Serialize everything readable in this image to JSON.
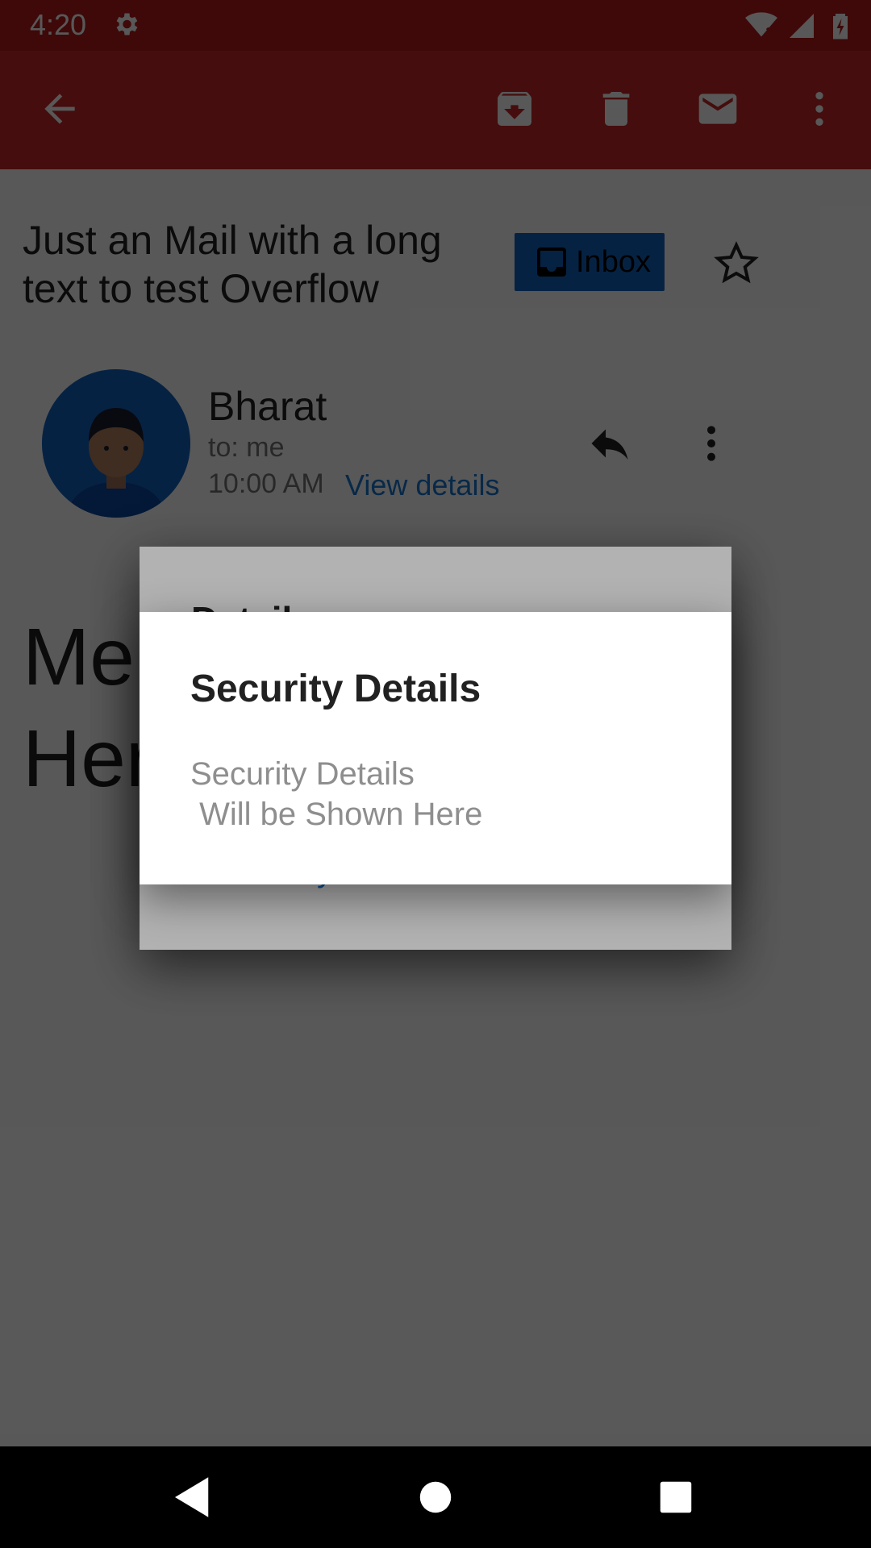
{
  "status_bar": {
    "time": "4:20"
  },
  "app_bar": {
    "icons": [
      "back-arrow-icon",
      "archive-icon",
      "delete-icon",
      "mail-icon",
      "more-vert-icon"
    ]
  },
  "email": {
    "subject": "Just an Mail with a long text to test Overflow",
    "label_chip": "Inbox",
    "sender": "Bharat",
    "to": "to: me",
    "time": "10:00 AM",
    "view_details": "View details",
    "body_visible": "Me\nHer"
  },
  "dialog_behind": {
    "title_partial": "Detail",
    "link_partial": "y"
  },
  "dialog": {
    "title": "Security Details",
    "message": "Security Details\n Will be Shown Here"
  },
  "colors": {
    "primary": "#c62828",
    "primary_dark": "#b71c1c",
    "chip": "#1565c0",
    "link": "#1976d2"
  }
}
